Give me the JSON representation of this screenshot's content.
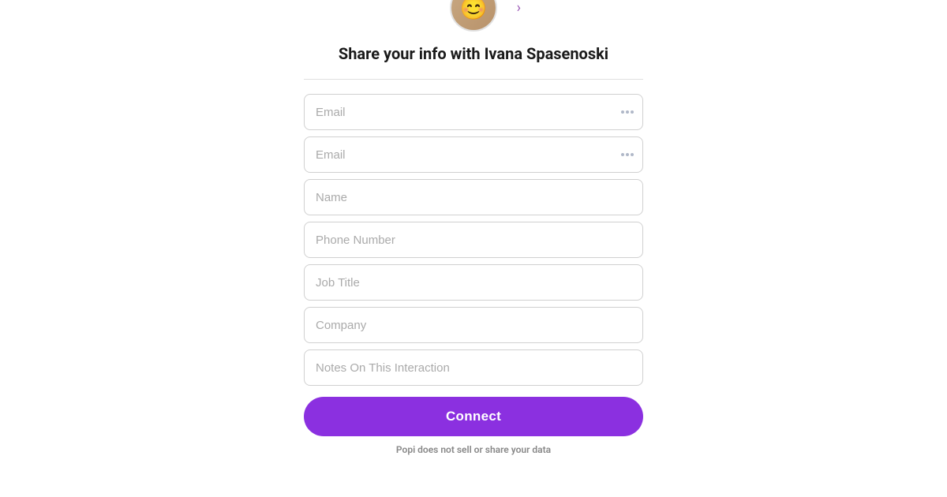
{
  "page": {
    "title": "Share your info with Ivana Spasenoski",
    "avatar": {
      "emoji": "😊",
      "alt": "Ivana Spasenoski avatar"
    },
    "divider": true,
    "form": {
      "fields": [
        {
          "id": "email1",
          "placeholder": "Email",
          "type": "email",
          "hasIcon": true
        },
        {
          "id": "email2",
          "placeholder": "Email",
          "type": "email",
          "hasIcon": true
        },
        {
          "id": "name",
          "placeholder": "Name",
          "type": "text",
          "hasIcon": false
        },
        {
          "id": "phone",
          "placeholder": "Phone Number",
          "type": "tel",
          "hasIcon": false
        },
        {
          "id": "job_title",
          "placeholder": "Job Title",
          "type": "text",
          "hasIcon": false
        },
        {
          "id": "company",
          "placeholder": "Company",
          "type": "text",
          "hasIcon": false
        },
        {
          "id": "notes",
          "placeholder": "Notes On This Interaction",
          "type": "text",
          "hasIcon": false
        }
      ],
      "submit_label": "Connect"
    },
    "privacy_text": "Popi does not sell or share your data",
    "chevron": "›",
    "colors": {
      "primary": "#8b30e0",
      "border": "#d0d0d0",
      "text_muted": "#aaa"
    }
  }
}
